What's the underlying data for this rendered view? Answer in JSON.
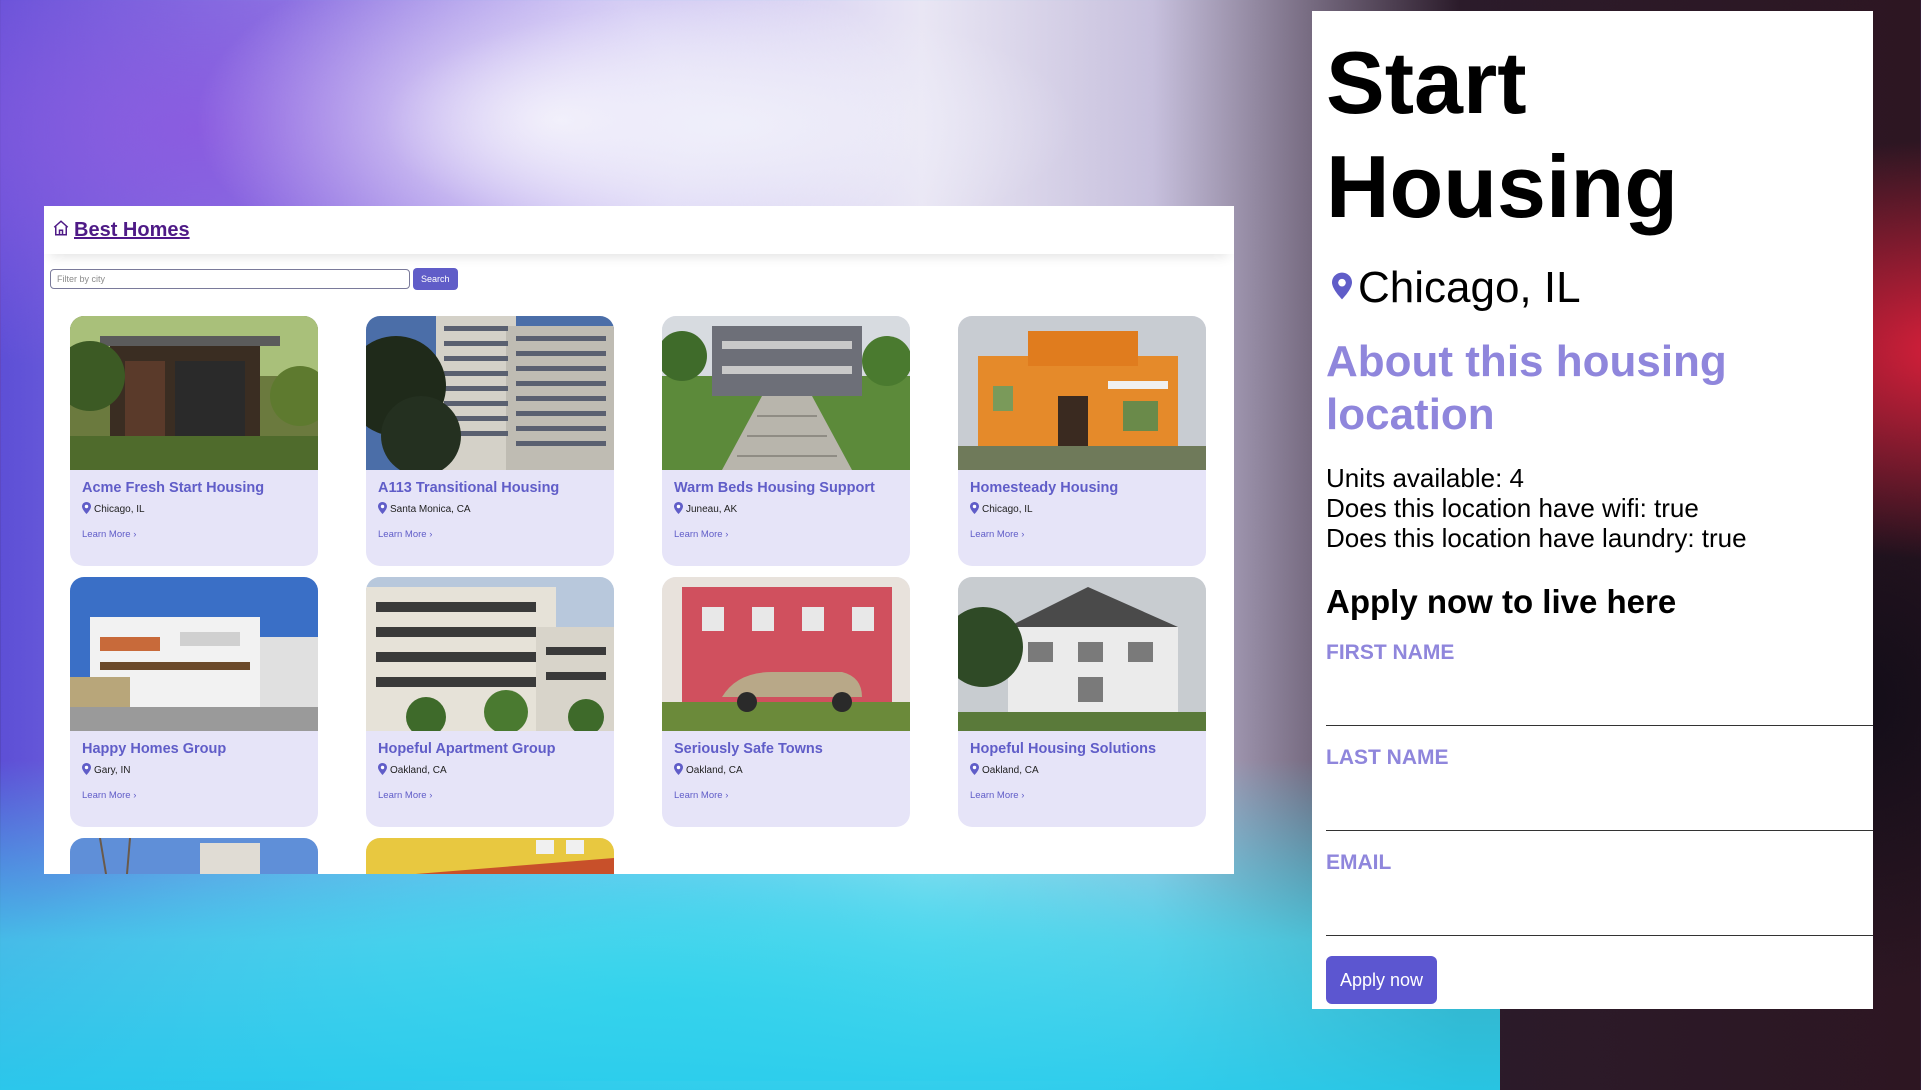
{
  "header": {
    "brand_label": "Best Homes"
  },
  "search": {
    "placeholder": "Filter by city",
    "button_label": "Search"
  },
  "locations": [
    {
      "name": "Acme Fresh Start Housing",
      "city": "Chicago, IL",
      "link": "Learn More ›"
    },
    {
      "name": "A113 Transitional Housing",
      "city": "Santa Monica, CA",
      "link": "Learn More ›"
    },
    {
      "name": "Warm Beds Housing Support",
      "city": "Juneau, AK",
      "link": "Learn More ›"
    },
    {
      "name": "Homesteady Housing",
      "city": "Chicago, IL",
      "link": "Learn More ›"
    },
    {
      "name": "Happy Homes Group",
      "city": "Gary, IN",
      "link": "Learn More ›"
    },
    {
      "name": "Hopeful Apartment Group",
      "city": "Oakland, CA",
      "link": "Learn More ›"
    },
    {
      "name": "Seriously Safe Towns",
      "city": "Oakland, CA",
      "link": "Learn More ›"
    },
    {
      "name": "Hopeful Housing Solutions",
      "city": "Oakland, CA",
      "link": "Learn More ›"
    }
  ],
  "detail": {
    "title": "Start Housing",
    "location": "Chicago, IL",
    "about_heading": "About this housing location",
    "features": [
      "Units available: 4",
      "Does this location have wifi: true",
      "Does this location have laundry: true"
    ],
    "apply_heading": "Apply now to live here",
    "form": {
      "first_name_label": "FIRST NAME",
      "last_name_label": "LAST NAME",
      "email_label": "EMAIL",
      "submit_label": "Apply now"
    }
  },
  "colors": {
    "accent": "#605dc8",
    "card_bg": "#e6e4f8",
    "heading_light": "#8f86dc",
    "brand": "#4e1a86"
  }
}
